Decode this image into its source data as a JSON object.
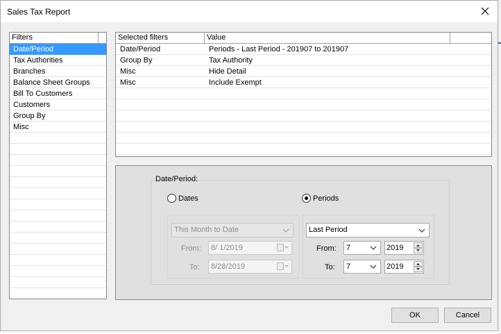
{
  "window": {
    "title": "Sales Tax Report"
  },
  "filters": {
    "header": "Filters",
    "items": [
      "Date/Period",
      "Tax Authorities",
      "Branches",
      "Balance Sheet Groups",
      "Bill To Customers",
      "Customers",
      "Group By",
      "Misc"
    ],
    "selected_index": 0
  },
  "selected_filters": {
    "col_filter": "Selected filters",
    "col_value": "Value",
    "rows": [
      {
        "filter": "Date/Period",
        "value": "Periods - Last Period - 201907 to 201907"
      },
      {
        "filter": "Group By",
        "value": "Tax Authority"
      },
      {
        "filter": "Misc",
        "value": "Hide Detail"
      },
      {
        "filter": "Misc",
        "value": "Include Exempt"
      }
    ]
  },
  "date_period": {
    "label": "Date/Period:",
    "dates_radio": {
      "label": "Dates",
      "checked": false
    },
    "periods_radio": {
      "label": "Periods",
      "checked": true
    },
    "dates": {
      "range_select": "This Month to Date",
      "from_label": "From:",
      "from_value": "8/ 1/2019",
      "to_label": "To:",
      "to_value": "8/28/2019"
    },
    "periods": {
      "range_select": "Last Period",
      "from_label": "From:",
      "from_period": "7",
      "from_year": "2019",
      "to_label": "To:",
      "to_period": "7",
      "to_year": "2019"
    }
  },
  "buttons": {
    "ok": "OK",
    "cancel": "Cancel"
  },
  "colors": {
    "selection": "#3399ff",
    "dialog_bg": "#f0f0f0",
    "group_bg": "#e0e0e0"
  }
}
